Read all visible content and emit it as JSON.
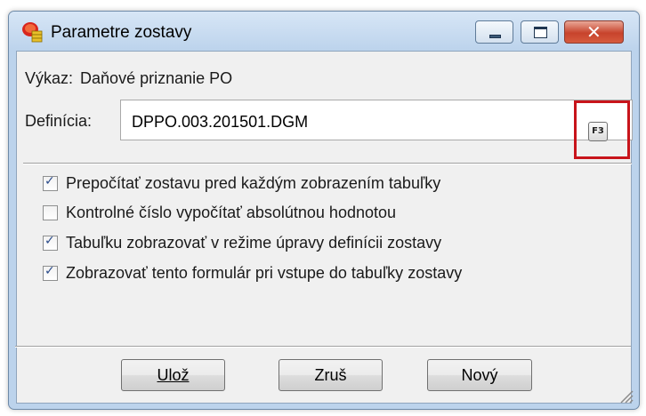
{
  "window": {
    "title": "Parametre zostavy"
  },
  "caption_buttons": {
    "close_glyph": "✕"
  },
  "report": {
    "label": "Výkaz:",
    "value": "Daňové priznanie PO"
  },
  "definition": {
    "label": "Definícia:",
    "value": "DPPO.003.201501.DGM",
    "lookup_key": "F3"
  },
  "options": [
    {
      "label": "Prepočítať zostavu pred každým zobrazením tabuľky",
      "checked": true
    },
    {
      "label": "Kontrolné číslo vypočítať absolútnou hodnotou",
      "checked": false
    },
    {
      "label": "Tabuľku zobrazovať v režime úpravy definícii zostavy",
      "checked": true
    },
    {
      "label": "Zobrazovať tento formulár pri vstupe do tabuľky zostavy",
      "checked": true
    }
  ],
  "buttons": {
    "save": "Ulož",
    "cancel": "Zruš",
    "new": "Nový"
  },
  "colors": {
    "highlight": "#c8141b",
    "title_bar": "#bcd3ec",
    "dialog_bg": "#f0f0f0"
  }
}
